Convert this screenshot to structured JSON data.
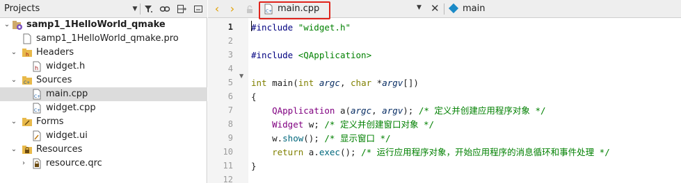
{
  "projects_pane": {
    "title": "Projects"
  },
  "tree": [
    {
      "label": "samp1_1HelloWorld_qmake",
      "bold": true,
      "arrow": "open",
      "icon": "qt-project-icon"
    },
    {
      "label": "samp1_1HelloWorld_qmake.pro",
      "arrow": "",
      "icon": "pro-file-icon"
    },
    {
      "label": "Headers",
      "arrow": "open",
      "icon": "headers-folder-icon"
    },
    {
      "label": "widget.h",
      "arrow": "",
      "icon": "header-file-icon"
    },
    {
      "label": "Sources",
      "arrow": "open",
      "icon": "sources-folder-icon"
    },
    {
      "label": "main.cpp",
      "arrow": "",
      "icon": "cpp-file-icon",
      "selected": true
    },
    {
      "label": "widget.cpp",
      "arrow": "",
      "icon": "cpp-file-icon"
    },
    {
      "label": "Forms",
      "arrow": "open",
      "icon": "forms-folder-icon"
    },
    {
      "label": "widget.ui",
      "arrow": "",
      "icon": "ui-file-icon"
    },
    {
      "label": "Resources",
      "arrow": "open",
      "icon": "resources-folder-icon"
    },
    {
      "label": "resource.qrc",
      "arrow": "closed",
      "icon": "qrc-file-icon"
    }
  ],
  "editor": {
    "file_name": "main.cpp",
    "symbol": "main",
    "current_line": "1",
    "line_numbers": [
      "1",
      "2",
      "3",
      "4",
      "5",
      "6",
      "7",
      "8",
      "9",
      "10",
      "11",
      "12"
    ]
  },
  "code_lines": [
    [
      [
        "pp",
        "#include "
      ],
      [
        "str",
        "\"widget.h\""
      ]
    ],
    [],
    [
      [
        "pp",
        "#include "
      ],
      [
        "str",
        "<QApplication>"
      ]
    ],
    [],
    [
      [
        "kw",
        "int"
      ],
      [
        "plain",
        " main("
      ],
      [
        "kw",
        "int"
      ],
      [
        "plain",
        " "
      ],
      [
        "param",
        "argc"
      ],
      [
        "plain",
        ", "
      ],
      [
        "kw",
        "char"
      ],
      [
        "plain",
        " *"
      ],
      [
        "param",
        "argv"
      ],
      [
        "plain",
        "[])"
      ]
    ],
    [
      [
        "plain",
        "{"
      ]
    ],
    [
      [
        "plain",
        "    "
      ],
      [
        "typ",
        "QApplication"
      ],
      [
        "plain",
        " a("
      ],
      [
        "param",
        "argc"
      ],
      [
        "plain",
        ", "
      ],
      [
        "param",
        "argv"
      ],
      [
        "plain",
        "); "
      ],
      [
        "cm",
        "/* 定义并创建应用程序对象 */"
      ]
    ],
    [
      [
        "plain",
        "    "
      ],
      [
        "typ",
        "Widget"
      ],
      [
        "plain",
        " w; "
      ],
      [
        "cm",
        "/* 定义并创建窗口对象 */"
      ]
    ],
    [
      [
        "plain",
        "    w."
      ],
      [
        "fn",
        "show"
      ],
      [
        "plain",
        "(); "
      ],
      [
        "cm",
        "/* 显示窗口 */"
      ]
    ],
    [
      [
        "plain",
        "    "
      ],
      [
        "kw",
        "return"
      ],
      [
        "plain",
        " a."
      ],
      [
        "fn",
        "exec"
      ],
      [
        "plain",
        "(); "
      ],
      [
        "cm",
        "/* 运行应用程序对象，开始应用程序的消息循环和事件处理 */"
      ]
    ],
    [
      [
        "plain",
        "}"
      ]
    ],
    []
  ],
  "colors": {
    "highlight_box": "#e0231b",
    "nav_arrow": "#e2a000",
    "selected_row": "#dcdcdc"
  }
}
